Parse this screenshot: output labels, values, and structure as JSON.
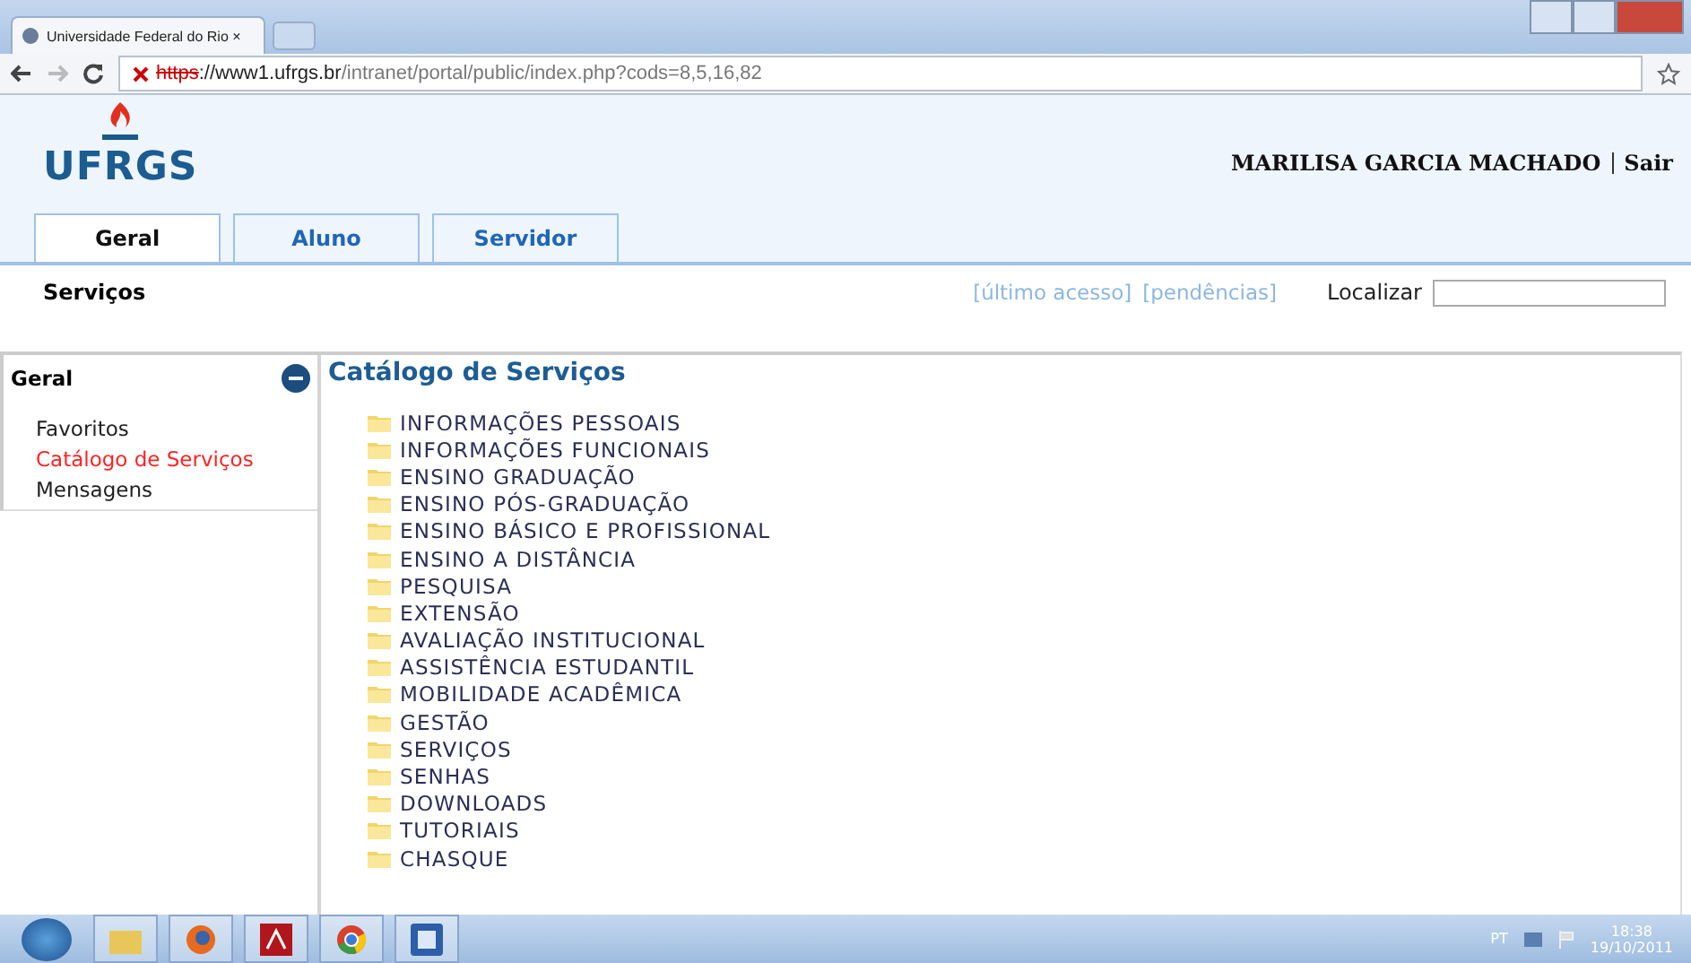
{
  "browser": {
    "tab_title": "Universidade Federal do Rio ×",
    "url_scheme": "https",
    "url_host": "://www1.ufrgs.br",
    "url_path": "/intranet/portal/public/index.php?cods=8,5,16,82"
  },
  "header": {
    "logo": "UFRGS",
    "user": "MARILISA GARCIA MACHADO",
    "logout": "Sair"
  },
  "tabs": [
    {
      "label": "Geral",
      "selected": true
    },
    {
      "label": "Aluno",
      "selected": false
    },
    {
      "label": "Servidor",
      "selected": false
    }
  ],
  "subheader": {
    "title": "Serviços",
    "links": [
      "[último acesso]",
      "[pendências]"
    ],
    "search_label": "Localizar"
  },
  "sidebar": {
    "title": "Geral",
    "expanded": true,
    "items": [
      {
        "label": "Favoritos",
        "selected": false
      },
      {
        "label": "Catálogo de Serviços",
        "selected": true
      },
      {
        "label": "Mensagens",
        "selected": false
      }
    ]
  },
  "catalog": {
    "title": "Catálogo de Serviços",
    "folders": [
      "INFORMAÇÕES PESSOAIS",
      "INFORMAÇÕES FUNCIONAIS",
      "ENSINO GRADUAÇÃO",
      "ENSINO PÓS-GRADUAÇÃO",
      "ENSINO BÁSICO E PROFISSIONAL",
      "ENSINO A DISTÂNCIA",
      "PESQUISA",
      "EXTENSÃO",
      "AVALIAÇÃO INSTITUCIONAL",
      "ASSISTÊNCIA ESTUDANTIL",
      "MOBILIDADE ACADÊMICA",
      "GESTÃO",
      "SERVIÇOS",
      "SENHAS",
      "DOWNLOADS",
      "TUTORIAIS",
      "CHASQUE"
    ]
  },
  "taskbar": {
    "language": "PT",
    "time": "18:38",
    "date": "19/10/2011"
  }
}
